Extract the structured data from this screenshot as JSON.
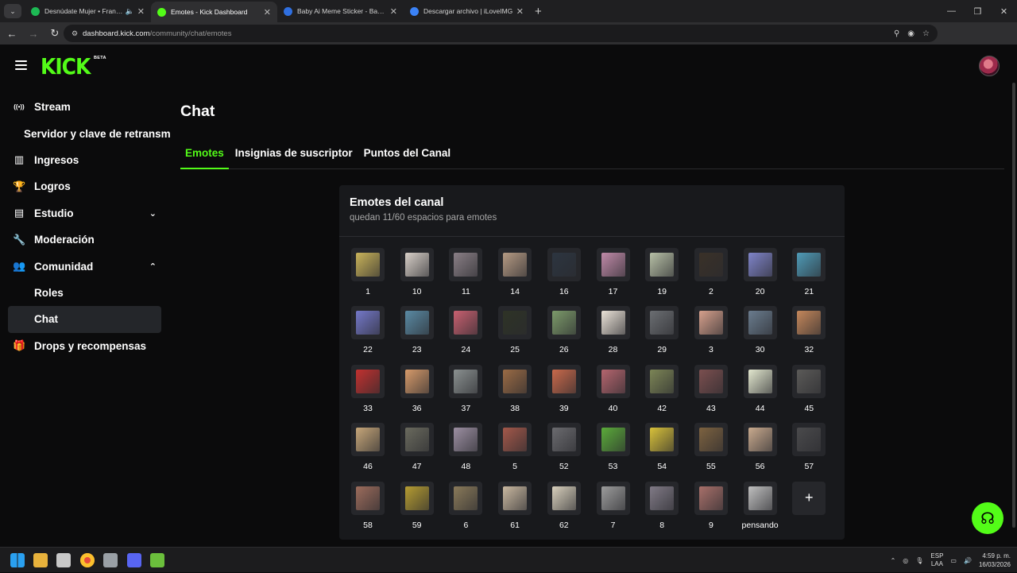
{
  "browser": {
    "tabs": [
      {
        "title": "Desnúdate Mujer • Frankie",
        "favicon_color": "#1db954",
        "audio": true,
        "active": false
      },
      {
        "title": "Emotes - Kick Dashboard",
        "favicon_color": "#53fc18",
        "audio": false,
        "active": true
      },
      {
        "title": "Baby Ai Meme Sticker - Baby a",
        "favicon_color": "#2f6fe0",
        "audio": false,
        "active": false
      },
      {
        "title": "Descargar archivo | iLoveIMG",
        "favicon_color": "#3b82f6",
        "audio": false,
        "active": false
      }
    ],
    "url_host": "dashboard.kick.com",
    "url_path": "/community/chat/emotes",
    "icons": [
      "back-icon",
      "forward-icon",
      "reload-icon",
      "zoom-icon",
      "eye-off-icon",
      "star-icon",
      "download-icon",
      "media-icon",
      "menu-icon"
    ]
  },
  "app": {
    "logo": "KICK",
    "logo_badge": "BETA",
    "brand_color": "#53fc18",
    "sidebar": [
      {
        "label": "Stream",
        "icon": "broadcast-icon",
        "type": "main"
      },
      {
        "label": "Servidor y clave de retransm",
        "icon": "",
        "type": "sub2"
      },
      {
        "label": "Ingresos",
        "icon": "chart-icon",
        "type": "main"
      },
      {
        "label": "Logros",
        "icon": "trophy-icon",
        "type": "main"
      },
      {
        "label": "Estudio",
        "icon": "studio-icon",
        "type": "main",
        "chevron": "down"
      },
      {
        "label": "Moderación",
        "icon": "wrench-icon",
        "type": "main"
      },
      {
        "label": "Comunidad",
        "icon": "community-icon",
        "type": "main",
        "chevron": "up"
      },
      {
        "label": "Roles",
        "icon": "",
        "type": "sub"
      },
      {
        "label": "Chat",
        "icon": "",
        "type": "sub",
        "active": true
      },
      {
        "label": "Drops y recompensas",
        "icon": "gift-icon",
        "type": "main"
      }
    ],
    "page_title": "Chat",
    "tabs": [
      {
        "label": "Emotes",
        "active": true
      },
      {
        "label": "Insignias de suscriptor",
        "active": false
      },
      {
        "label": "Puntos del Canal",
        "active": false
      }
    ],
    "panel": {
      "title": "Emotes del canal",
      "subtitle": "quedan 11/60 espacios para emotes"
    },
    "emotes": [
      {
        "name": "1",
        "color": "#c9b35a"
      },
      {
        "name": "10",
        "color": "#d8d0c8"
      },
      {
        "name": "11",
        "color": "#8a7f86"
      },
      {
        "name": "14",
        "color": "#b59a83"
      },
      {
        "name": "16",
        "color": "#2c3540"
      },
      {
        "name": "17",
        "color": "#c08aa8"
      },
      {
        "name": "19",
        "color": "#b7c0a6"
      },
      {
        "name": "2",
        "color": "#3a3128"
      },
      {
        "name": "20",
        "color": "#7f84c9"
      },
      {
        "name": "21",
        "color": "#4f9bb7"
      },
      {
        "name": "22",
        "color": "#7478c9"
      },
      {
        "name": "23",
        "color": "#5a8aa4"
      },
      {
        "name": "24",
        "color": "#c86070"
      },
      {
        "name": "25",
        "color": "#2e3326"
      },
      {
        "name": "26",
        "color": "#7c9a6a"
      },
      {
        "name": "28",
        "color": "#ebe3d8"
      },
      {
        "name": "29",
        "color": "#6b6e72"
      },
      {
        "name": "3",
        "color": "#d6a08c"
      },
      {
        "name": "30",
        "color": "#6a7c8e"
      },
      {
        "name": "32",
        "color": "#c4875b"
      },
      {
        "name": "33",
        "color": "#c2312f"
      },
      {
        "name": "36",
        "color": "#d69a6a"
      },
      {
        "name": "37",
        "color": "#8a9090"
      },
      {
        "name": "38",
        "color": "#9a6b45"
      },
      {
        "name": "39",
        "color": "#c9694b"
      },
      {
        "name": "40",
        "color": "#b5656e"
      },
      {
        "name": "42",
        "color": "#7c8556"
      },
      {
        "name": "43",
        "color": "#7b4f4f"
      },
      {
        "name": "44",
        "color": "#e3e8cf"
      },
      {
        "name": "45",
        "color": "#5b5a58"
      },
      {
        "name": "46",
        "color": "#c6a679"
      },
      {
        "name": "47",
        "color": "#6a6a5e"
      },
      {
        "name": "48",
        "color": "#9c8fa2"
      },
      {
        "name": "5",
        "color": "#a3584a"
      },
      {
        "name": "52",
        "color": "#6b6b6f"
      },
      {
        "name": "53",
        "color": "#5bab3a"
      },
      {
        "name": "54",
        "color": "#d8c13a"
      },
      {
        "name": "55",
        "color": "#7d6240"
      },
      {
        "name": "56",
        "color": "#c9aa8e"
      },
      {
        "name": "57",
        "color": "#4a4a4c"
      },
      {
        "name": "58",
        "color": "#9c6c5c"
      },
      {
        "name": "59",
        "color": "#b59c32"
      },
      {
        "name": "6",
        "color": "#8a7a5a"
      },
      {
        "name": "61",
        "color": "#c9b8a0"
      },
      {
        "name": "62",
        "color": "#d8d0bc"
      },
      {
        "name": "7",
        "color": "#9c9c9c"
      },
      {
        "name": "8",
        "color": "#807a86"
      },
      {
        "name": "9",
        "color": "#a8706a"
      },
      {
        "name": "pensando",
        "color": "#bfbfbf"
      }
    ],
    "add_emote_icon": "plus-icon",
    "help_icon": "headset-icon"
  },
  "taskbar": {
    "apps": [
      {
        "icon": "windows-start-icon",
        "color": "#2aa0f0"
      },
      {
        "icon": "file-explorer-icon",
        "color": "#e8b23c"
      },
      {
        "icon": "app-icon",
        "color": "#c8c8c8"
      },
      {
        "icon": "chrome-icon",
        "color": "#e64a3c"
      },
      {
        "icon": "github-desktop-icon",
        "color": "#9aa0a6"
      },
      {
        "icon": "discord-icon",
        "color": "#5865f2"
      },
      {
        "icon": "app-icon-2",
        "color": "#6bbf3c"
      }
    ],
    "lang_line1": "ESP",
    "lang_line2": "LAA",
    "time": "4:59 p. m.",
    "date": "16/03/2026"
  }
}
